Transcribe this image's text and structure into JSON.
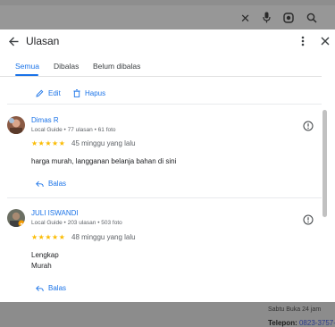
{
  "background": {
    "icons": [
      "close-icon",
      "mic-icon",
      "lens-icon",
      "search-icon"
    ],
    "phone_label": "Telepon:",
    "phone_number": "0823-3757-",
    "top_fragment": "Sabtu Buka 24 jam"
  },
  "dialog": {
    "title": "Ulasan",
    "back_icon": "arrow-left-icon",
    "more_icon": "more-vert-icon",
    "close_icon": "close-icon",
    "accent": "#1a73e8"
  },
  "tabs": [
    {
      "label": "Semua",
      "active": true
    },
    {
      "label": "Dibalas",
      "active": false
    },
    {
      "label": "Belum dibalas",
      "active": false
    }
  ],
  "own_review_actions": {
    "edit_label": "Edit",
    "delete_label": "Hapus"
  },
  "reviews": [
    {
      "name": "Dimas R",
      "meta": "Local Guide • 77 ulasan • 61 foto",
      "rating": 5,
      "stars": "★★★★★",
      "time": "45 minggu yang lalu",
      "text_lines": [
        "harga murah, langganan belanja bahan di sini"
      ],
      "reply_label": "Balas"
    },
    {
      "name": "JULI ISWANDI",
      "meta": "Local Guide • 203 ulasan • 503 foto",
      "rating": 5,
      "stars": "★★★★★",
      "time": "48 minggu yang lalu",
      "text_lines": [
        "Lengkap",
        "Murah"
      ],
      "reply_label": "Balas"
    }
  ]
}
